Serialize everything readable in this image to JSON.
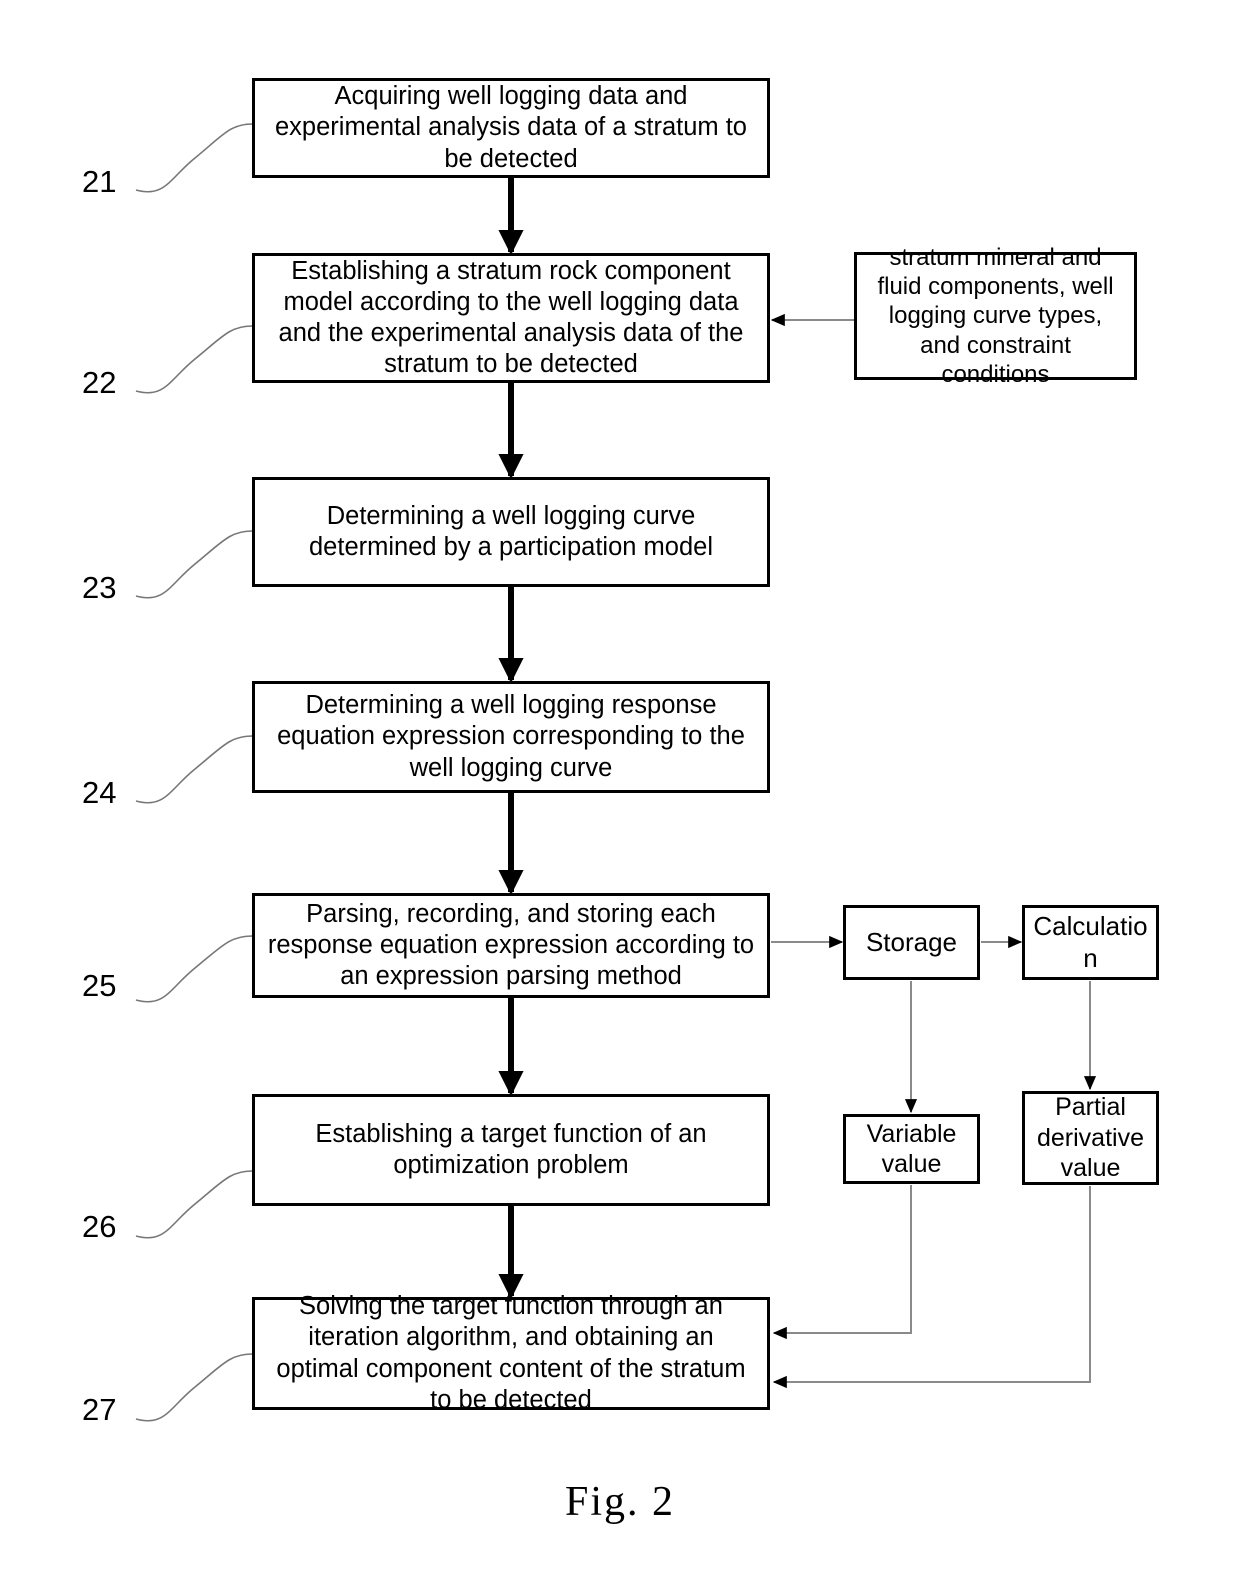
{
  "figure": {
    "caption": "Fig. 2",
    "accent_color": "#000000",
    "connector_color": "#808080",
    "background_color": "#ffffff"
  },
  "steps": [
    {
      "number": "21",
      "label": "Acquiring well logging data and\nexperimental analysis data of a stratum to\nbe detected"
    },
    {
      "number": "22",
      "label": "Establishing a stratum rock component\nmodel according to the well logging data\nand the experimental analysis data of the\nstratum to be detected"
    },
    {
      "number": "23",
      "label": "Determining a well logging curve\ndetermined by a participation model"
    },
    {
      "number": "24",
      "label": "Determining a well logging response\nequation expression corresponding to the\nwell logging curve"
    },
    {
      "number": "25",
      "label": "Parsing, recording, and storing each\nresponse equation expression according to\nan expression parsing method"
    },
    {
      "number": "26",
      "label": "Establishing a target function of an\noptimization problem"
    },
    {
      "number": "27",
      "label": "Solving the target function through an\niteration algorithm, and obtaining an\noptimal component content of the stratum\nto be detected"
    }
  ],
  "aux_boxes": {
    "inputs": "stratum mineral and\nfluid components, well\nlogging curve types,\nand constraint\nconditions",
    "storage": "Storage",
    "calculation": "Calculatio\nn",
    "variable_value": "Variable\nvalue",
    "partial_derivative_value": "Partial\nderivative\nvalue"
  },
  "chart_data": {
    "type": "diagram",
    "title": "Fig. 2",
    "nodes": [
      {
        "id": "21",
        "text": "Acquiring well logging data and experimental analysis data of a stratum to be detected"
      },
      {
        "id": "22",
        "text": "Establishing a stratum rock component model according to the well logging data and the experimental analysis data of the stratum to be detected"
      },
      {
        "id": "23",
        "text": "Determining a well logging curve determined by a participation model"
      },
      {
        "id": "24",
        "text": "Determining a well logging response equation expression corresponding to the well logging curve"
      },
      {
        "id": "25",
        "text": "Parsing, recording, and storing each response equation expression according to an expression parsing method"
      },
      {
        "id": "26",
        "text": "Establishing a target function of an optimization problem"
      },
      {
        "id": "27",
        "text": "Solving the target function through an iteration algorithm, and obtaining an optimal component content of the stratum to be detected"
      },
      {
        "id": "inputs",
        "text": "stratum mineral and fluid components, well logging curve types, and constraint conditions"
      },
      {
        "id": "storage",
        "text": "Storage"
      },
      {
        "id": "calculation",
        "text": "Calculation"
      },
      {
        "id": "variable_value",
        "text": "Variable value"
      },
      {
        "id": "partial_derivative_value",
        "text": "Partial derivative value"
      }
    ],
    "edges": [
      {
        "from": "21",
        "to": "22",
        "style": "thick-down"
      },
      {
        "from": "22",
        "to": "23",
        "style": "thick-down"
      },
      {
        "from": "23",
        "to": "24",
        "style": "thick-down"
      },
      {
        "from": "24",
        "to": "25",
        "style": "thick-down"
      },
      {
        "from": "25",
        "to": "26",
        "style": "thick-down"
      },
      {
        "from": "26",
        "to": "27",
        "style": "thick-down"
      },
      {
        "from": "inputs",
        "to": "22",
        "style": "thin-left"
      },
      {
        "from": "25",
        "to": "storage",
        "style": "thin-right"
      },
      {
        "from": "storage",
        "to": "calculation",
        "style": "thin-right"
      },
      {
        "from": "storage",
        "to": "variable_value",
        "style": "thin-down"
      },
      {
        "from": "calculation",
        "to": "partial_derivative_value",
        "style": "thin-down"
      },
      {
        "from": "variable_value",
        "to": "27",
        "style": "thin-elbow-left"
      },
      {
        "from": "partial_derivative_value",
        "to": "27",
        "style": "thin-elbow-left"
      }
    ]
  }
}
